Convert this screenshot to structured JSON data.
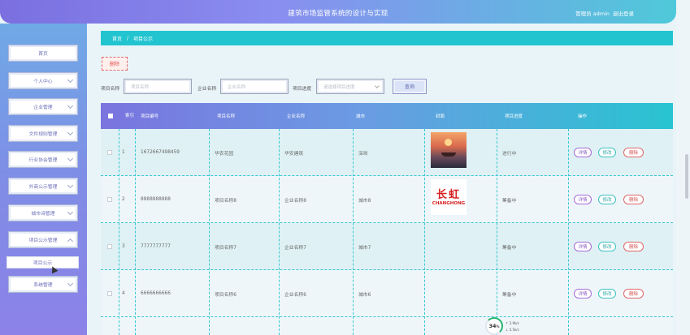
{
  "header": {
    "title": "建筑市场监管系统的设计与实现",
    "user": "管理员 admin",
    "logout": "退出登录"
  },
  "sidebar": {
    "items": [
      {
        "label": "首页",
        "expandable": false
      },
      {
        "label": "个人中心",
        "expandable": true
      },
      {
        "label": "企业管理",
        "expandable": true
      },
      {
        "label": "文件规则管理",
        "expandable": true
      },
      {
        "label": "行业协会管理",
        "expandable": true
      },
      {
        "label": "外商公示管理",
        "expandable": true
      },
      {
        "label": "城市诗管理",
        "expandable": true
      },
      {
        "label": "项目公示管理",
        "expandable": true,
        "open": true
      },
      {
        "label": "系统管理",
        "expandable": true
      }
    ],
    "subitem": "项目公示"
  },
  "breadcrumb": {
    "home": "首页",
    "separator": "/",
    "current": "项目公示"
  },
  "toolbar": {
    "delete_label": "删除",
    "search_label": "查询"
  },
  "filters": {
    "project_name": {
      "label": "项目名称",
      "placeholder": "项目名称"
    },
    "company_name": {
      "label": "企业名称",
      "placeholder": "企业名称"
    },
    "progress": {
      "label": "项目进度",
      "placeholder": "请选择项目进度"
    }
  },
  "table": {
    "headers": [
      "索引",
      "项目编号",
      "项目名称",
      "企业名称",
      "城市",
      "封面",
      "项目进度",
      "操作"
    ],
    "rows": [
      {
        "index": "1",
        "code": "1672667498459",
        "name": "华农花园",
        "company": "华安建筑",
        "city": "深圳",
        "cover": "photo",
        "progress": "进行中"
      },
      {
        "index": "2",
        "code": "8888888888",
        "name": "项目名称8",
        "company": "企业名称8",
        "city": "城市8",
        "cover": "logo",
        "progress": "筹备中"
      },
      {
        "index": "3",
        "code": "7777777777",
        "name": "项目名称7",
        "company": "企业名称7",
        "city": "城市7",
        "cover": "",
        "progress": "筹备中"
      },
      {
        "index": "4",
        "code": "6666666666",
        "name": "项目名称6",
        "company": "企业名称6",
        "city": "城市6",
        "cover": "",
        "progress": "筹备中"
      }
    ],
    "actions": {
      "detail": "详情",
      "edit": "修改",
      "remove": "删除"
    },
    "logo_cn": "长虹",
    "logo_en": "CHANGHONG"
  },
  "widget": {
    "percent": "34",
    "unit": "%",
    "up": "↑ 2.9k/s",
    "down": "↓ 5.5k/s"
  },
  "colors": {
    "accent": "#22c4d0",
    "header_start": "#7b6fe0",
    "header_end": "#4fc9d9",
    "danger": "#e25050"
  }
}
